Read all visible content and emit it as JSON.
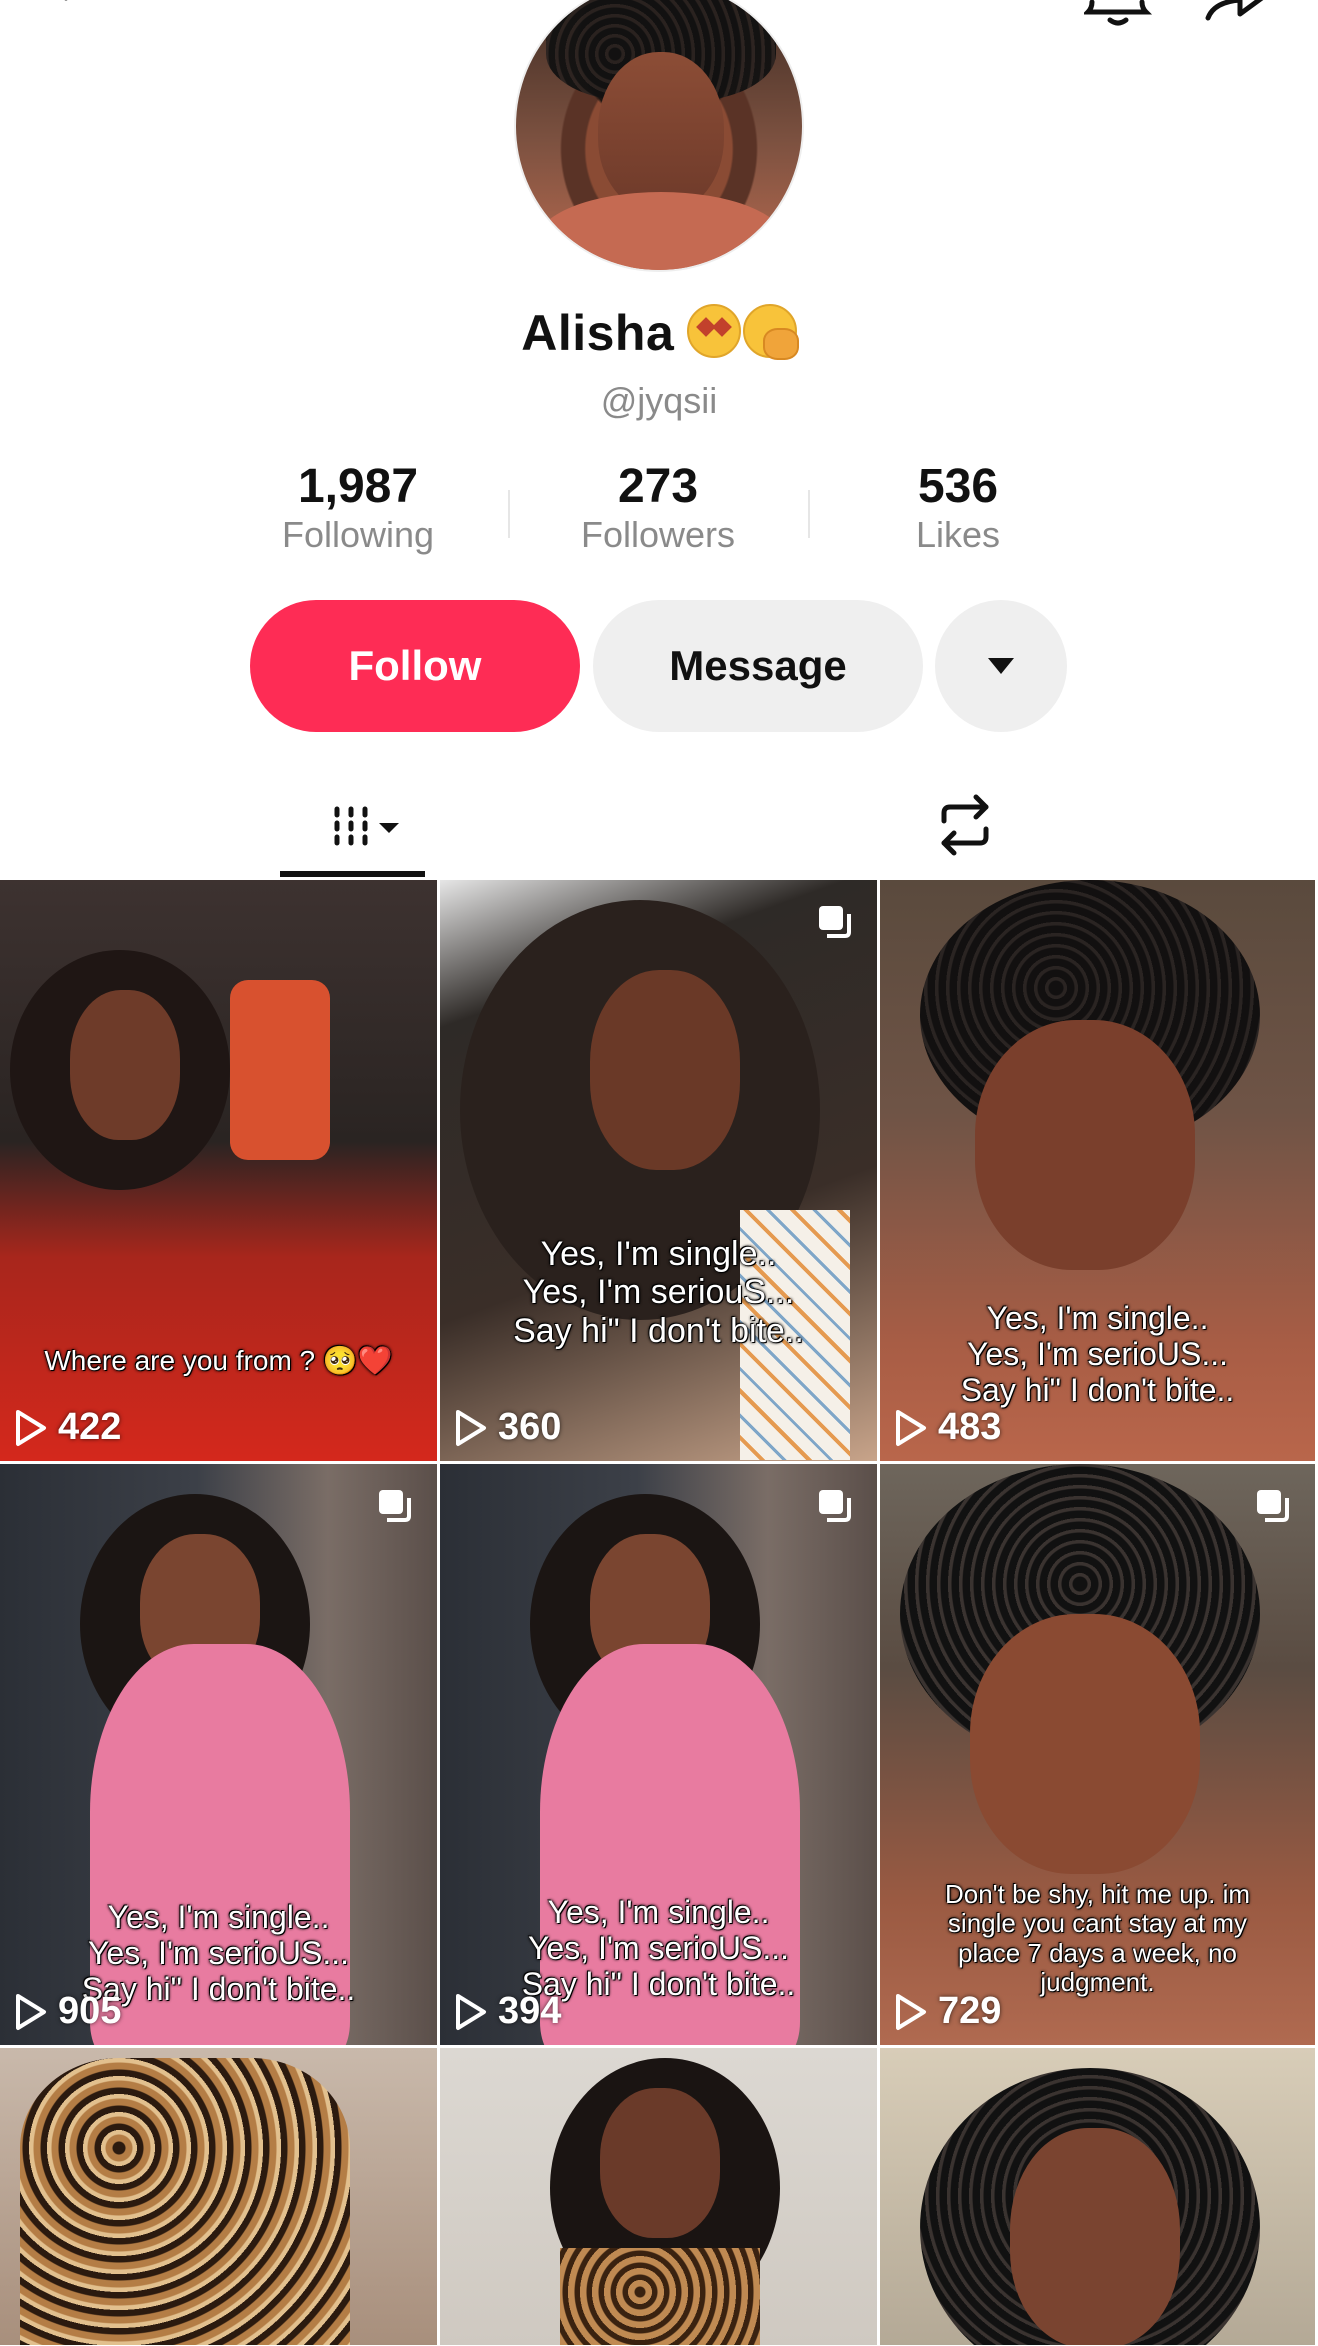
{
  "profile": {
    "name": "Alisha",
    "handle": "@jyqsii",
    "emoji_icons": [
      "star-struck-emoji-icon",
      "face-with-hand-over-mouth-emoji-icon"
    ]
  },
  "stats": [
    {
      "value": "1,987",
      "label": "Following"
    },
    {
      "value": "273",
      "label": "Followers"
    },
    {
      "value": "536",
      "label": "Likes"
    }
  ],
  "actions": {
    "follow_label": "Follow",
    "message_label": "Message",
    "more_icon": "caret-down-icon"
  },
  "colors": {
    "accent": "#fe2c55",
    "secondary_button": "#efefef",
    "muted_text": "#8a8a8a"
  },
  "tabs": [
    {
      "name": "videos",
      "icon": "grid-icon",
      "active": true
    },
    {
      "name": "reposts",
      "icon": "repost-icon",
      "active": false
    }
  ],
  "videos": [
    {
      "caption": "Where are you from ? 🥺❤️",
      "views": "422",
      "multi": false
    },
    {
      "caption": "Yes, I'm single..\nYes, I'm seriouS...\nSay hi\" I don't bite..",
      "views": "360",
      "multi": true
    },
    {
      "caption": "Yes, I'm single..\nYes, I'm serioUS...\nSay hi\" I don't bite..",
      "views": "483",
      "multi": false
    },
    {
      "caption": "Yes, I'm single..\nYes, I'm serioUS...\nSay hi\" I don't bite..",
      "views": "905",
      "multi": true
    },
    {
      "caption": "Yes, I'm single..\nYes, I'm serioUS...\nSay hi\" I don't bite..",
      "views": "394",
      "multi": true
    },
    {
      "caption": "Don't be shy, hit  me up. im\nsingle you cant stay at my\nplace 7 days a week, no\njudgment.",
      "views": "729",
      "multi": true
    },
    {
      "caption": "",
      "views": "",
      "multi": false
    },
    {
      "caption": "",
      "views": "",
      "multi": false
    },
    {
      "caption": "",
      "views": "",
      "multi": false
    }
  ]
}
